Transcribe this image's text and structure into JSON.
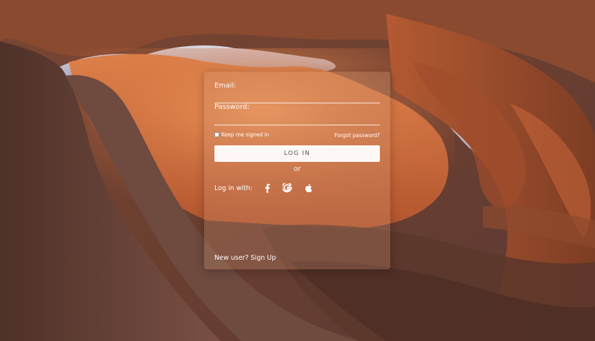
{
  "login": {
    "email_label": "Email:",
    "password_label": "Password:",
    "keep_signed_in_label": "Keep me signed in",
    "forgot_password_label": "Forgot password?",
    "login_button_label": "LOG IN",
    "or_label": "or",
    "social_label": "Log in with:",
    "signup_label": "New user? Sign Up",
    "social_icons": [
      "facebook-icon",
      "google-icon",
      "apple-icon"
    ]
  }
}
